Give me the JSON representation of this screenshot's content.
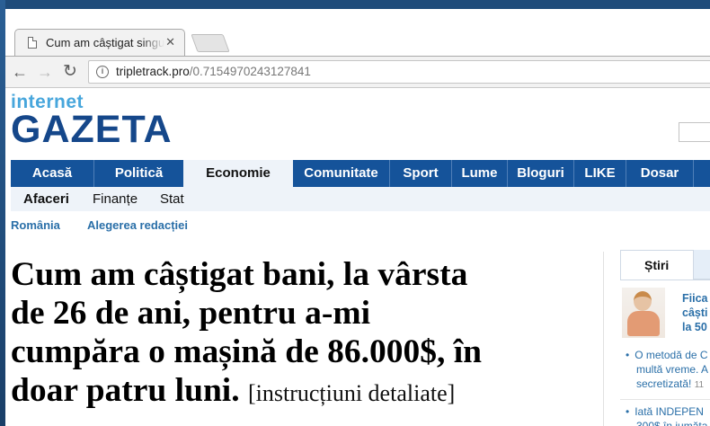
{
  "browser": {
    "tab_title": "Cum am câștigat singură",
    "tab_close": "✕",
    "url_host": "tripletrack.pro",
    "url_path": "/0.7154970243127841",
    "back": "←",
    "forward": "→",
    "reload": "↻"
  },
  "site": {
    "logo_small": "internet",
    "logo_big": "GAZETA"
  },
  "main_nav": {
    "items": [
      {
        "label": "Acasă"
      },
      {
        "label": "Politică"
      },
      {
        "label": "Economie",
        "active": true
      },
      {
        "label": "Comunitate"
      },
      {
        "label": "Sport"
      },
      {
        "label": "Lume"
      },
      {
        "label": "Bloguri"
      },
      {
        "label": "LIKE"
      },
      {
        "label": "Dosar"
      }
    ]
  },
  "sub_nav": {
    "items": [
      {
        "label": "Afaceri",
        "active": true
      },
      {
        "label": "Finanțe"
      },
      {
        "label": "Stat"
      }
    ]
  },
  "crumbs": {
    "items": [
      {
        "label": "România"
      },
      {
        "label": "Alegerea redacției"
      }
    ]
  },
  "article": {
    "headline_lines": [
      "Cum am câștigat bani, la vârsta",
      "de 26 de ani, pentru a-mi",
      "cumpăra o mașină de 86.000$, în",
      "doar patru luni."
    ],
    "headline_note": "[instrucțiuni detaliate]"
  },
  "sidebar": {
    "tab_label": "Știri",
    "featured_lines": [
      "Fiica",
      "câști",
      "la 50"
    ],
    "news": [
      {
        "lines": [
          "O metodă de C",
          "multă vreme. A",
          "secretizată!"
        ],
        "time": "11"
      },
      {
        "lines": [
          "Iată INDEPEN",
          "300$ în jumăta"
        ]
      }
    ]
  }
}
